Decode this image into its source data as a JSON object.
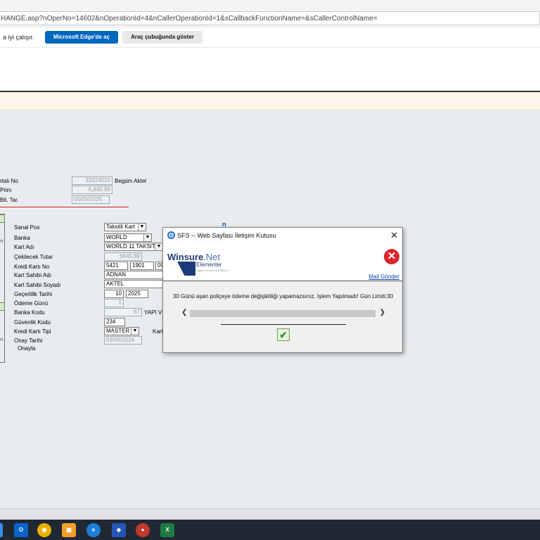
{
  "browser": {
    "address": "HANGE.asp?nOperNo=14602&nOperationId=4&nCallerOperationId=1&sCallbackFunctionName=&sCallerControlName=",
    "info_text": "a iyi çalışır.",
    "open_edge_label": "Microsoft Edge'de aç",
    "show_toolbar_label": "Araç çubuğunda göster"
  },
  "policy": {
    "labels": [
      "rtalı No",
      "Prim",
      "Bit. Tar."
    ],
    "number": "33324020",
    "insured_name": "Begüm Aktel",
    "prim": "6,845.89",
    "end_date": "05/05/2025"
  },
  "payment_form": {
    "labels": {
      "sanal_pos": "Sanal Pos",
      "banka": "Banka",
      "kart_adi": "Kart Adı",
      "cekilecek_tutar": "Çekilecek Tutar",
      "kredi_karti_no": "Kredi Kartı No",
      "kart_sahibi_adi": "Kart Sahibi Adı",
      "kart_sahibi_soyadi": "Kart Sahibi Soyadı",
      "gecerlilik": "Geçerlilik Tarihi",
      "odeme_gunu": "Ödeme Günü",
      "banka_kodu": "Banka Kodu",
      "guvenlik_kodu": "Güvenlik Kodu",
      "kredi_karti_tipi": "Kredi Kartı Tipi",
      "onay_tarihi": "Onay Tarihi",
      "onayla": "Onayla",
      "kart_partial": "Kart"
    },
    "values": {
      "sanal_pos": "Taksitli Kart",
      "banka": "WORLD",
      "kart_adi": "WORLD 11 TAKSIT",
      "cekilecek_tutar": "6845.89",
      "card_part1": "5421",
      "card_part2": "1901",
      "card_part3": "09",
      "kart_sahibi_adi": "ADNAN",
      "kart_sahibi_soyadi": "AKTEL",
      "gecerlilik_ay": "10",
      "gecerlilik_yil": "2025",
      "odeme_gunu": "1",
      "banka_kodu": "67",
      "banka_adi_partial": "YAPI VE",
      "guvenlik_kodu": "234",
      "kredi_karti_tipi": "MASTER",
      "onay_tarihi": "03/06/2024"
    }
  },
  "dialog": {
    "title": "SFS -- Web Sayfası İletişim Kutusu",
    "logo_main": "Winsure",
    "logo_suffix": ".Net",
    "logo_sub": "Elementer",
    "logo_tag": "Digital Insurance Platform",
    "mail_link": "Mail Gönder",
    "message": "30 Günü aşan poliçeye ödeme değişikliliği yapamazsınız. İşlem Yapılmadı! Gün Limiti:30"
  },
  "taskbar": {
    "icons": [
      "outlook-icon",
      "chrome-icon",
      "store-icon",
      "edge-icon",
      "security-icon",
      "app-icon",
      "excel-icon"
    ]
  },
  "colors": {
    "accent_blue": "#0067c0",
    "content_bg": "#e9ecef",
    "error_red": "#d9262c",
    "taskbar": "#1f2833"
  }
}
